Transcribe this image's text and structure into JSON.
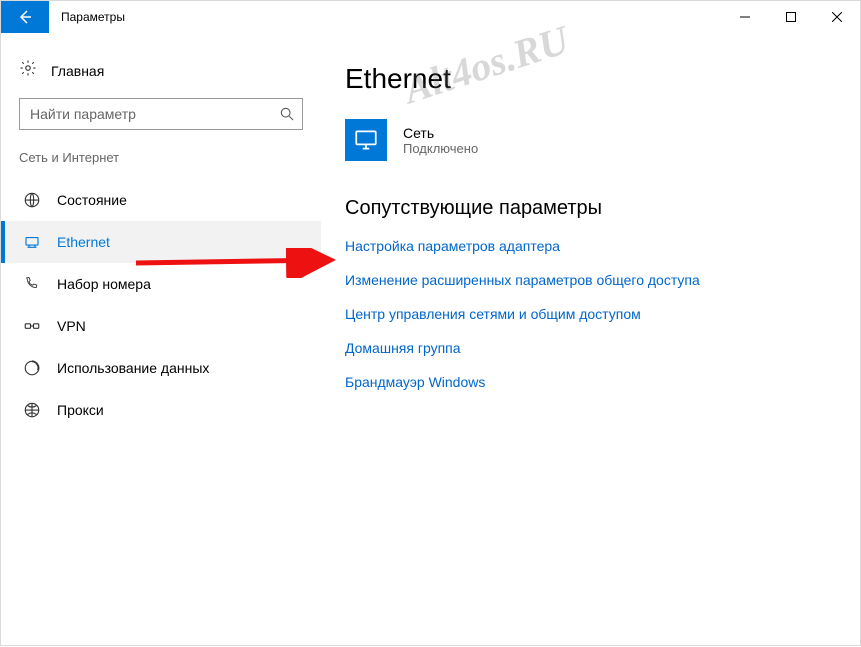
{
  "window": {
    "title": "Параметры"
  },
  "sidebar": {
    "home_label": "Главная",
    "search_placeholder": "Найти параметр",
    "section_label": "Сеть и Интернет",
    "items": [
      {
        "label": "Состояние"
      },
      {
        "label": "Ethernet"
      },
      {
        "label": "Набор номера"
      },
      {
        "label": "VPN"
      },
      {
        "label": "Использование данных"
      },
      {
        "label": "Прокси"
      }
    ]
  },
  "main": {
    "title": "Ethernet",
    "network": {
      "name": "Сеть",
      "status": "Подключено"
    },
    "related_heading": "Сопутствующие параметры",
    "links": [
      "Настройка параметров адаптера",
      "Изменение расширенных параметров общего доступа",
      "Центр управления сетями и общим доступом",
      "Домашняя группа",
      "Брандмауэр Windows"
    ]
  },
  "watermark": "Alt4os.RU"
}
